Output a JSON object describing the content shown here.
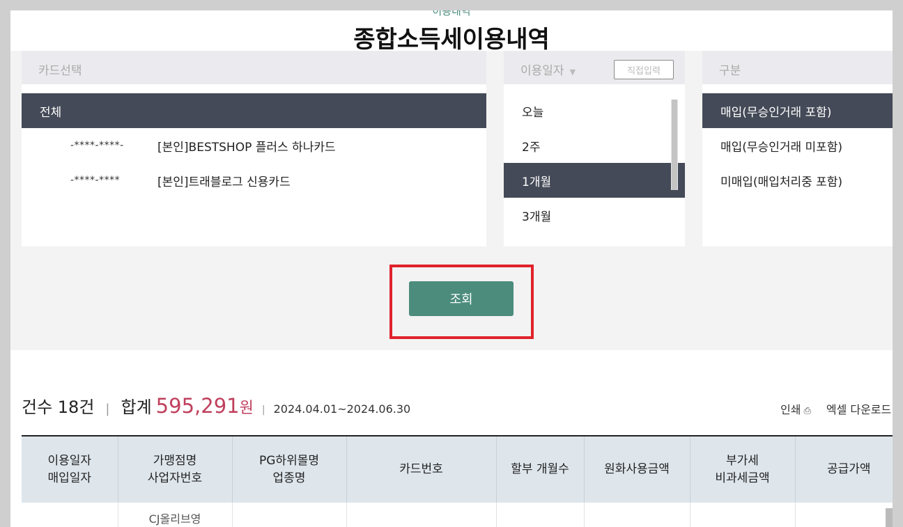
{
  "page": {
    "subtitle": "이용내역",
    "title": "종합소득세이용내역"
  },
  "card_panel": {
    "header": "카드선택",
    "items": [
      {
        "number": "",
        "name": "전체",
        "selected": true
      },
      {
        "number": "-****-****-",
        "name": "[본인]BESTSHOP 플러스 하나카드",
        "selected": false
      },
      {
        "number": "-****-****",
        "name": "[본인]트래블로그 신용카드",
        "selected": false
      }
    ]
  },
  "date_panel": {
    "header": "이용일자",
    "caret": "▼",
    "direct_button": "직접입력",
    "items": [
      {
        "label": "오늘",
        "selected": false
      },
      {
        "label": "2주",
        "selected": false
      },
      {
        "label": "1개월",
        "selected": true
      },
      {
        "label": "3개월",
        "selected": false
      }
    ]
  },
  "type_panel": {
    "header": "구분",
    "items": [
      {
        "label": "매입(무승인거래 포함)",
        "selected": true
      },
      {
        "label": "매입(무승인거래 미포함)",
        "selected": false
      },
      {
        "label": "미매입(매입처리중 포함)",
        "selected": false
      }
    ]
  },
  "search_button": "조회",
  "summary": {
    "count": "건수 18건",
    "total_label": "합계",
    "total_amount": "595,291",
    "currency": "원",
    "period": "2024.04.01~2024.06.30"
  },
  "actions": {
    "print": "인쇄",
    "print_icon": "print-icon",
    "excel": "엑셀 다운로드",
    "excel_icon": "download-icon"
  },
  "table": {
    "columns": [
      [
        "이용일자",
        "매입일자"
      ],
      [
        "가맹점명",
        "사업자번호"
      ],
      [
        "PG하위몰명",
        "업종명"
      ],
      [
        "카드번호"
      ],
      [
        "할부 개월수"
      ],
      [
        "원화사용금액"
      ],
      [
        "부가세",
        "비과세금액"
      ],
      [
        "공급가액"
      ]
    ],
    "rows": [
      [
        "",
        "CJ올리브영",
        "",
        "",
        "",
        "",
        "",
        ""
      ]
    ]
  },
  "colors": {
    "accent": "#4b8c7d",
    "selected": "#444a57",
    "amount": "#c0405e",
    "highlight": "#e0222a"
  }
}
